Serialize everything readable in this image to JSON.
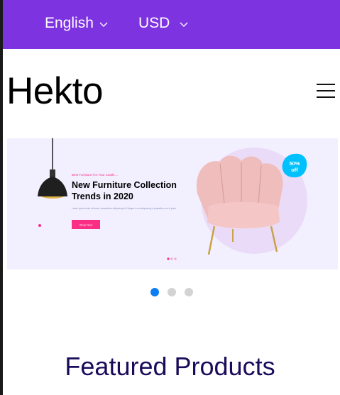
{
  "topbar": {
    "language": "English",
    "currency": "USD",
    "background": "#7e33e0"
  },
  "brand": {
    "name": "Hekto"
  },
  "hero": {
    "kicker": "Best Furniture For Your Castle....",
    "title_line1": "New Furniture Collection",
    "title_line2": "Trends in 2020",
    "body": "Lorem ipsum dolor sit amet, consectetur adipiscing elit. Magna in est adipiscing in phasellus non in justo.",
    "button_label": "Shop Now",
    "discount_line1": "50%",
    "discount_line2": "off",
    "accent": "#fb2e86"
  },
  "carousel": {
    "active_index": 0,
    "count": 3,
    "active_color": "#0d7df2",
    "inactive_color": "#d3d3d3"
  },
  "section": {
    "title": "Featured Products"
  }
}
